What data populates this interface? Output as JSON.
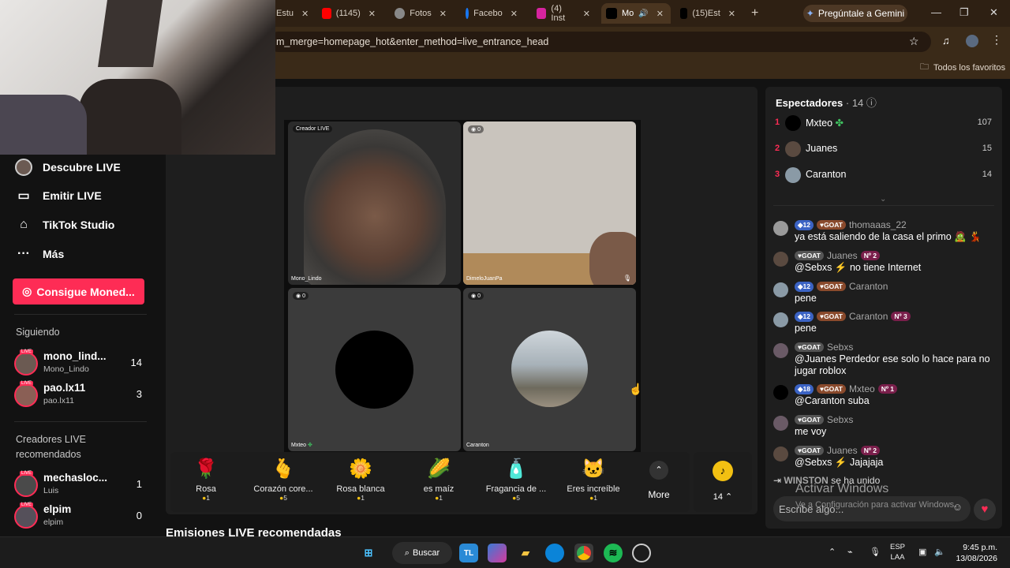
{
  "browser": {
    "tabs": [
      {
        "label": "Estu",
        "icon": "page-icon"
      },
      {
        "label": "(1145)",
        "icon": "youtube-icon"
      },
      {
        "label": "Fotos",
        "icon": "gear-icon"
      },
      {
        "label": "Facebo",
        "icon": "facebook-icon"
      },
      {
        "label": "(4) Inst",
        "icon": "instagram-icon"
      },
      {
        "label": "Mo",
        "icon": "tiktok-icon"
      },
      {
        "label": "(15)Est",
        "icon": "tiktok-icon"
      }
    ],
    "gemini_label": "Pregúntale a Gemini",
    "url": "m_merge=homepage_hot&enter_method=live_entrance_head",
    "bookmarks_label": "Todos los favoritos"
  },
  "sidebar": {
    "nav": [
      {
        "label": "Descubre LIVE",
        "icon": "live-avatar-icon"
      },
      {
        "label": "Emitir LIVE",
        "icon": "camera-icon"
      },
      {
        "label": "TikTok Studio",
        "icon": "studio-icon"
      },
      {
        "label": "Más",
        "icon": "more-icon"
      }
    ],
    "coins_button": "Consigue Moned...",
    "following_title": "Siguiendo",
    "following": [
      {
        "name": "mono_lind...",
        "handle": "Mono_Lindo",
        "count": "14"
      },
      {
        "name": "pao.lx11",
        "handle": "pao.lx11",
        "count": "3"
      }
    ],
    "recommended_title": "Creadores LIVE recomendados",
    "recommended": [
      {
        "name": "mechasloc...",
        "handle": "Luis",
        "count": "1"
      },
      {
        "name": "elpim",
        "handle": "elpim",
        "count": "0"
      }
    ],
    "live_tag": "LIVE"
  },
  "stream": {
    "cells": [
      {
        "tag": "Creador LIVE",
        "label": "Mono_Lindo"
      },
      {
        "tag": "0",
        "label": "DimeloJuanPa"
      },
      {
        "tag": "0",
        "label": "Mxteo"
      },
      {
        "tag": "0",
        "label": "Caranton"
      }
    ]
  },
  "gifts": [
    {
      "name": "Rosa",
      "price": "1",
      "icon": "rose-icon"
    },
    {
      "name": "Corazón core...",
      "price": "5",
      "icon": "heart-hand-icon"
    },
    {
      "name": "Rosa blanca",
      "price": "1",
      "icon": "white-rose-icon"
    },
    {
      "name": "es maíz",
      "price": "1",
      "icon": "corn-icon"
    },
    {
      "name": "Fragancia de ...",
      "price": "5",
      "icon": "perfume-icon"
    },
    {
      "name": "Eres increíble",
      "price": "1",
      "icon": "cat-icon"
    }
  ],
  "gifts_more": "More",
  "coin_count": "14",
  "recommended_streams_title": "Emisiones LIVE recomendadas",
  "panel": {
    "title": "Espectadores",
    "count": "· 14",
    "viewers": [
      {
        "rank": "1",
        "name": "Mxteo",
        "score": "107"
      },
      {
        "rank": "2",
        "name": "Juanes",
        "score": "15"
      },
      {
        "rank": "3",
        "name": "Caranton",
        "score": "14"
      }
    ],
    "messages": [
      {
        "user": "thomaaas_22",
        "level": "12",
        "goat": "GOAT",
        "rank": "",
        "text": "ya está saliendo de la casa el primo 🧟 💃"
      },
      {
        "user": "Juanes",
        "level": "",
        "goat": "GOAT",
        "rank": "Nº 2",
        "text": "@Sebxs ⚡ no tiene Internet"
      },
      {
        "user": "Caranton",
        "level": "12",
        "goat": "GOAT",
        "rank": "",
        "text": "pene"
      },
      {
        "user": "Caranton",
        "level": "12",
        "goat": "GOAT",
        "rank": "Nº 3",
        "text": "pene"
      },
      {
        "user": "Sebxs",
        "level": "",
        "goat": "GOAT",
        "rank": "",
        "text": "@Juanes Perdedor ese solo lo hace para no jugar roblox"
      },
      {
        "user": "Mxteo",
        "level": "18",
        "goat": "GOAT",
        "rank": "Nº 1",
        "text": "@Caranton suba"
      },
      {
        "user": "Sebxs",
        "level": "",
        "goat": "GOAT",
        "rank": "",
        "text": "me voy"
      },
      {
        "user": "Juanes",
        "level": "",
        "goat": "GOAT",
        "rank": "Nº 2",
        "text": "@Sebxs ⚡ Jajajaja"
      }
    ],
    "joined_user": "WINSTON",
    "joined_text": "se ha unido",
    "input_placeholder": "Escribe algo..."
  },
  "watermark": {
    "title": "Activar Windows",
    "subtitle": "Ve a Configuración para activar Windows."
  },
  "taskbar": {
    "search_label": "Buscar",
    "lang": "ESP",
    "region": "LAA",
    "time": "9:45 p.m.",
    "date": "13/08/2026"
  }
}
